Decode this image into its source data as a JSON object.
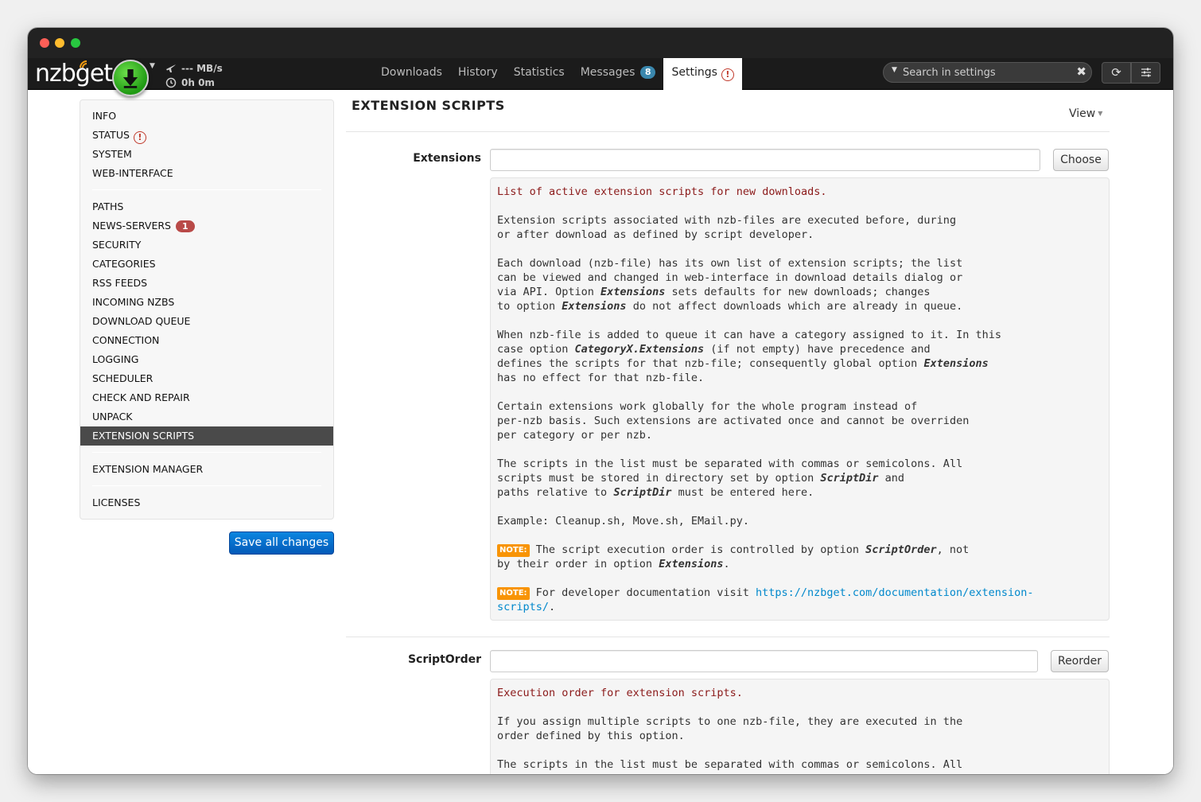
{
  "app": {
    "logo": "nzbget",
    "speed": "--- MB/s",
    "time": "0h 0m"
  },
  "nav": {
    "tabs": [
      {
        "label": "Downloads"
      },
      {
        "label": "History"
      },
      {
        "label": "Statistics"
      },
      {
        "label": "Messages",
        "badge": "8"
      },
      {
        "label": "Settings",
        "warning": "!"
      }
    ],
    "search_placeholder": "Search in settings"
  },
  "sidebar": {
    "group1": [
      "INFO",
      "STATUS",
      "SYSTEM",
      "WEB-INTERFACE"
    ],
    "status_warning": "!",
    "group2": [
      "PATHS",
      "NEWS-SERVERS",
      "SECURITY",
      "CATEGORIES",
      "RSS FEEDS",
      "INCOMING NZBS",
      "DOWNLOAD QUEUE",
      "CONNECTION",
      "LOGGING",
      "SCHEDULER",
      "CHECK AND REPAIR",
      "UNPACK",
      "EXTENSION SCRIPTS"
    ],
    "news_servers_badge": "1",
    "group3": [
      "EXTENSION MANAGER"
    ],
    "group4": [
      "LICENSES"
    ],
    "active": "EXTENSION SCRIPTS",
    "save_label": "Save all changes"
  },
  "main": {
    "heading": "EXTENSION SCRIPTS",
    "view_label": "View",
    "options": [
      {
        "label": "Extensions",
        "value": "",
        "button": "Choose",
        "lead": "List of active extension scripts for new downloads.",
        "p1": "Extension scripts associated with nzb-files are executed before, during\nor after download as defined by script developer.",
        "p2_a": "Each download (nzb-file) has its own list of extension scripts; the list\ncan be viewed and changed in web-interface in download details dialog or\nvia API. Option ",
        "p2_opt1": "Extensions",
        "p2_b": " sets defaults for new downloads; changes\nto option ",
        "p2_opt2": "Extensions",
        "p2_c": " do not affect downloads which are already in queue.",
        "p3_a": "When nzb-file is added to queue it can have a category assigned to it. In this\ncase option ",
        "p3_opt1": "CategoryX.Extensions",
        "p3_b": " (if not empty) have precedence and\ndefines the scripts for that nzb-file; consequently global option ",
        "p3_opt2": "Extensions",
        "p3_c": "\nhas no effect for that nzb-file.",
        "p4": "Certain extensions work globally for the whole program instead of\nper-nzb basis. Such extensions are activated once and cannot be overriden\nper category or per nzb.",
        "p5_a": "The scripts in the list must be separated with commas or semicolons. All\nscripts must be stored in directory set by option ",
        "p5_opt1": "ScriptDir",
        "p5_b": " and\npaths relative to ",
        "p5_opt2": "ScriptDir",
        "p5_c": " must be entered here.",
        "p6": "Example: Cleanup.sh, Move.sh, EMail.py.",
        "note_label": "NOTE:",
        "n1_a": " The script execution order is controlled by option ",
        "n1_opt1": "ScriptOrder",
        "n1_b": ", not\nby their order in option ",
        "n1_opt2": "Extensions",
        "n1_c": ".",
        "n2_a": " For developer documentation visit ",
        "n2_link": "https://nzbget.com/documentation/extension-\nscripts/",
        "n2_c": "."
      },
      {
        "label": "ScriptOrder",
        "value": "",
        "button": "Reorder",
        "lead": "Execution order for extension scripts.",
        "p1": "If you assign multiple scripts to one nzb-file, they are executed in the\norder defined by this option.",
        "p2": "The scripts in the list must be separated with commas or semicolons. All"
      }
    ]
  },
  "colors": {
    "active_sidebar": "#4a4a4a",
    "save_button": "#0a6ccf",
    "lead_text": "#8b1a1a",
    "note_badge": "#f89406",
    "link": "#0088cc",
    "news_badge": "#b94a48",
    "messages_badge": "#3a87ad"
  },
  "icons": {
    "speed": "plane-icon",
    "time": "clock-icon",
    "download": "download-arrow-icon",
    "refresh": "refresh-icon",
    "prefs": "sliders-icon",
    "clear": "close-icon"
  }
}
